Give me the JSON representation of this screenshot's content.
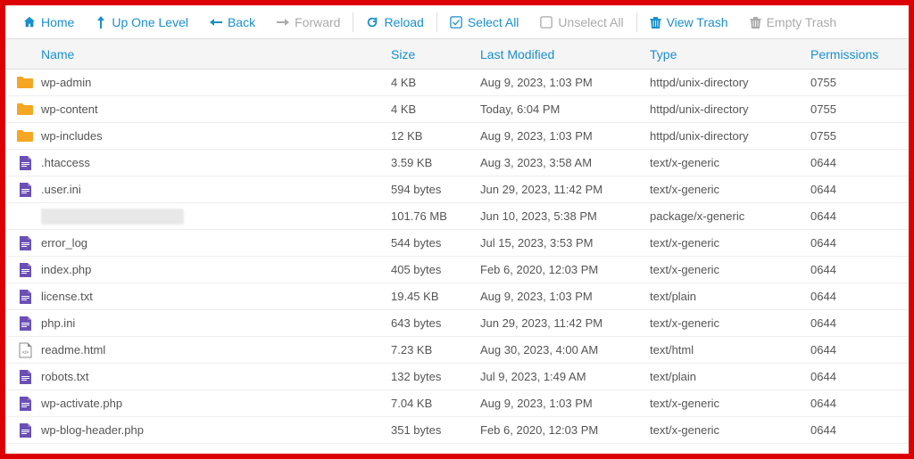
{
  "toolbar": {
    "home": "Home",
    "up": "Up One Level",
    "back": "Back",
    "forward": "Forward",
    "reload": "Reload",
    "selectAll": "Select All",
    "unselectAll": "Unselect All",
    "viewTrash": "View Trash",
    "emptyTrash": "Empty Trash"
  },
  "columns": {
    "name": "Name",
    "size": "Size",
    "modified": "Last Modified",
    "type": "Type",
    "permissions": "Permissions"
  },
  "files": [
    {
      "icon": "folder",
      "name": "wp-admin",
      "size": "4 KB",
      "modified": "Aug 9, 2023, 1:03 PM",
      "type": "httpd/unix-directory",
      "perm": "0755"
    },
    {
      "icon": "folder",
      "name": "wp-content",
      "size": "4 KB",
      "modified": "Today, 6:04 PM",
      "type": "httpd/unix-directory",
      "perm": "0755"
    },
    {
      "icon": "folder",
      "name": "wp-includes",
      "size": "12 KB",
      "modified": "Aug 9, 2023, 1:03 PM",
      "type": "httpd/unix-directory",
      "perm": "0755"
    },
    {
      "icon": "doc",
      "name": ".htaccess",
      "size": "3.59 KB",
      "modified": "Aug 3, 2023, 3:58 AM",
      "type": "text/x-generic",
      "perm": "0644"
    },
    {
      "icon": "doc",
      "name": ".user.ini",
      "size": "594 bytes",
      "modified": "Jun 29, 2023, 11:42 PM",
      "type": "text/x-generic",
      "perm": "0644"
    },
    {
      "icon": "blur",
      "name": "",
      "size": "101.76 MB",
      "modified": "Jun 10, 2023, 5:38 PM",
      "type": "package/x-generic",
      "perm": "0644"
    },
    {
      "icon": "doc",
      "name": "error_log",
      "size": "544 bytes",
      "modified": "Jul 15, 2023, 3:53 PM",
      "type": "text/x-generic",
      "perm": "0644"
    },
    {
      "icon": "doc",
      "name": "index.php",
      "size": "405 bytes",
      "modified": "Feb 6, 2020, 12:03 PM",
      "type": "text/x-generic",
      "perm": "0644"
    },
    {
      "icon": "doc",
      "name": "license.txt",
      "size": "19.45 KB",
      "modified": "Aug 9, 2023, 1:03 PM",
      "type": "text/plain",
      "perm": "0644"
    },
    {
      "icon": "doc",
      "name": "php.ini",
      "size": "643 bytes",
      "modified": "Jun 29, 2023, 11:42 PM",
      "type": "text/x-generic",
      "perm": "0644"
    },
    {
      "icon": "html",
      "name": "readme.html",
      "size": "7.23 KB",
      "modified": "Aug 30, 2023, 4:00 AM",
      "type": "text/html",
      "perm": "0644"
    },
    {
      "icon": "doc",
      "name": "robots.txt",
      "size": "132 bytes",
      "modified": "Jul 9, 2023, 1:49 AM",
      "type": "text/plain",
      "perm": "0644"
    },
    {
      "icon": "doc",
      "name": "wp-activate.php",
      "size": "7.04 KB",
      "modified": "Aug 9, 2023, 1:03 PM",
      "type": "text/x-generic",
      "perm": "0644"
    },
    {
      "icon": "doc",
      "name": "wp-blog-header.php",
      "size": "351 bytes",
      "modified": "Feb 6, 2020, 12:03 PM",
      "type": "text/x-generic",
      "perm": "0644"
    }
  ]
}
